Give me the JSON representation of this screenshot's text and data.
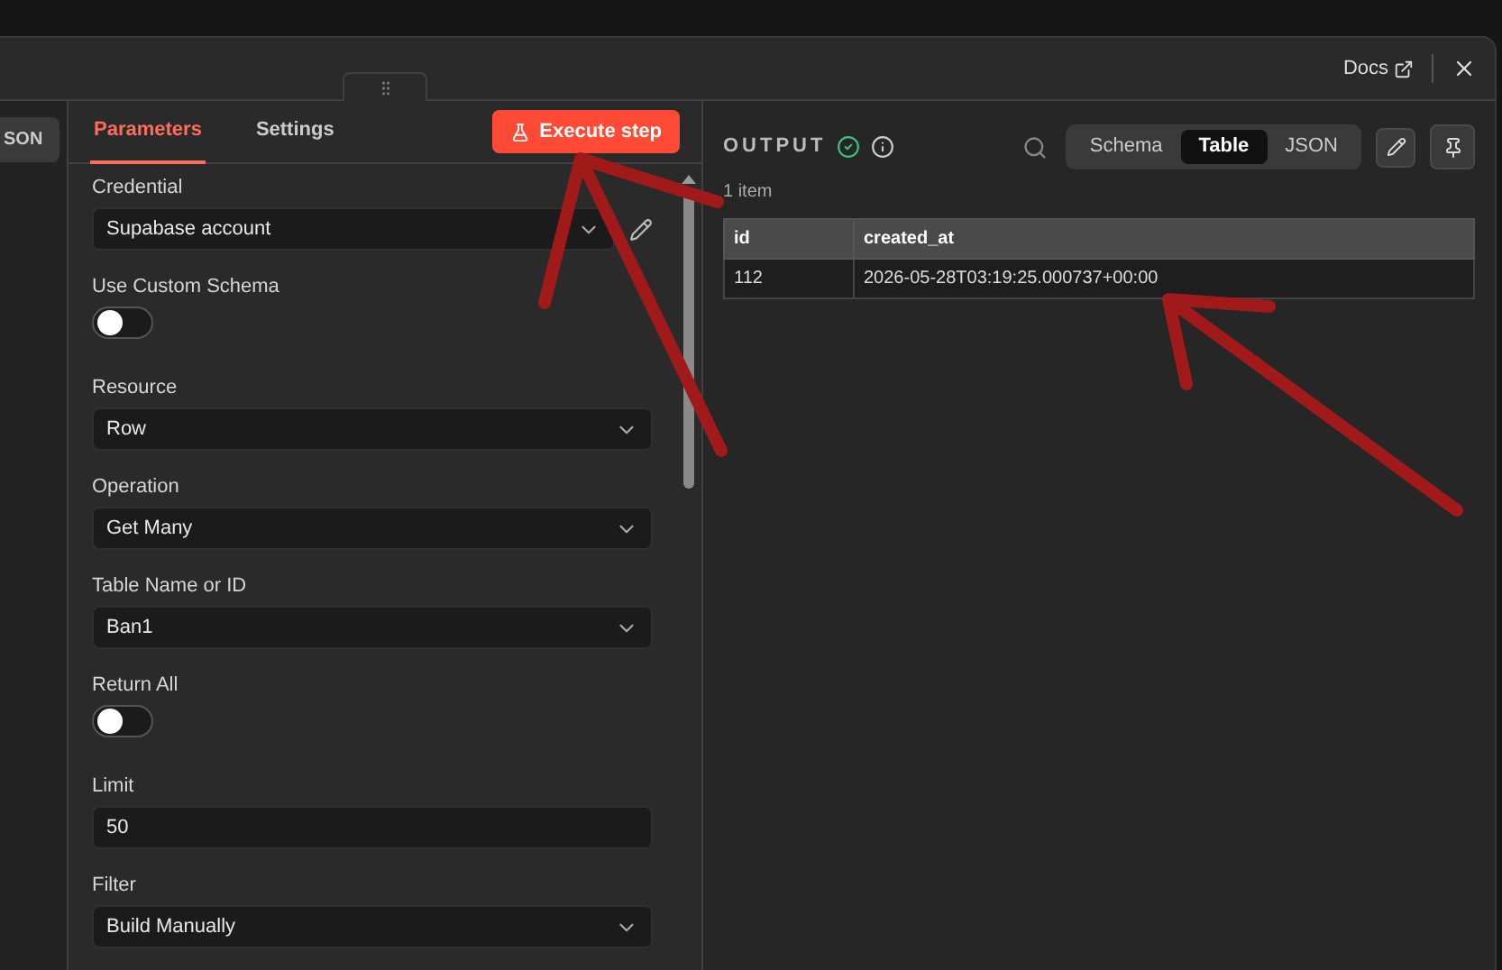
{
  "header": {
    "docs_link": "Docs"
  },
  "left_strip": {
    "button": "SON"
  },
  "parameters_panel": {
    "tabs": [
      {
        "label": "Parameters",
        "selected": true
      },
      {
        "label": "Settings",
        "selected": false
      }
    ],
    "execute_button": "Execute step",
    "fields": [
      {
        "kind": "select",
        "label": "Credential",
        "value": "Supabase account",
        "editable": true
      },
      {
        "kind": "toggle",
        "label": "Use Custom Schema",
        "on": false
      },
      {
        "kind": "select",
        "label": "Resource",
        "value": "Row"
      },
      {
        "kind": "select",
        "label": "Operation",
        "value": "Get Many"
      },
      {
        "kind": "select",
        "label": "Table Name or ID",
        "value": "Ban1"
      },
      {
        "kind": "toggle",
        "label": "Return All",
        "on": false
      },
      {
        "kind": "input",
        "label": "Limit",
        "value": "50"
      },
      {
        "kind": "select",
        "label": "Filter",
        "value": "Build Manually"
      }
    ]
  },
  "output_panel": {
    "title": "OUTPUT",
    "views": [
      {
        "label": "Schema",
        "selected": false
      },
      {
        "label": "Table",
        "selected": true
      },
      {
        "label": "JSON",
        "selected": false
      }
    ],
    "item_count": "1 item",
    "table": {
      "columns": [
        "id",
        "created_at"
      ],
      "rows": [
        [
          "112",
          "2026-05-28T03:19:25.000737+00:00"
        ]
      ]
    }
  }
}
